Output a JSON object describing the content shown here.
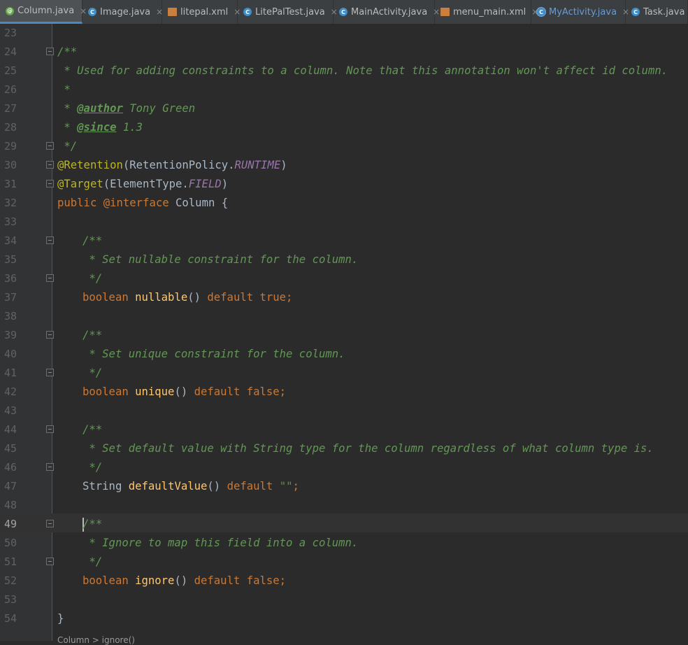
{
  "tabs": [
    {
      "label": "Column.java",
      "icon": "annotation-icon",
      "active": true
    },
    {
      "label": "Image.java",
      "icon": "class-icon"
    },
    {
      "label": "litepal.xml",
      "icon": "xml-icon"
    },
    {
      "label": "LitePalTest.java",
      "icon": "class-icon"
    },
    {
      "label": "MainActivity.java",
      "icon": "class-icon"
    },
    {
      "label": "menu_main.xml",
      "icon": "xml-icon"
    },
    {
      "label": "MyActivity.java",
      "icon": "class-icon"
    },
    {
      "label": "Task.java",
      "icon": "class-icon"
    }
  ],
  "close_glyph": "×",
  "line_numbers": [
    "23",
    "24",
    "25",
    "26",
    "27",
    "28",
    "29",
    "30",
    "31",
    "32",
    "33",
    "34",
    "35",
    "36",
    "37",
    "38",
    "39",
    "40",
    "41",
    "42",
    "43",
    "44",
    "45",
    "46",
    "47",
    "48",
    "49",
    "50",
    "51",
    "52",
    "53",
    "54"
  ],
  "current_line": "49",
  "code": {
    "l24": "/**",
    "l25": " * Used for adding constraints to a column. Note that this annotation won't affect id column.",
    "l26": " *",
    "l27_star": " * ",
    "l27_tag": "@author",
    "l27_text": " Tony Green",
    "l28_star": " * ",
    "l28_tag": "@since",
    "l28_text": " 1.3",
    "l29": " */",
    "l30_anno": "@Retention",
    "l30_open": "(RetentionPolicy.",
    "l30_const": "RUNTIME",
    "l30_close": ")",
    "l31_anno": "@Target",
    "l31_open": "(ElementType.",
    "l31_const": "FIELD",
    "l31_close": ")",
    "l32_kw1": "public",
    "l32_kw2": "@interface",
    "l32_name": "Column",
    "l32_brace": "{",
    "l34": "/**",
    "l35": " * Set nullable constraint for the column.",
    "l36": " */",
    "l37_type": "boolean",
    "l37_name": "nullable",
    "l37_paren": "()",
    "l37_kw": "default",
    "l37_val": "true;",
    "l39": "/**",
    "l40": " * Set unique constraint for the column.",
    "l41": " */",
    "l42_type": "boolean",
    "l42_name": "unique",
    "l42_paren": "()",
    "l42_kw": "default",
    "l42_val": "false;",
    "l44": "/**",
    "l45": " * Set default value with String type for the column regardless of what column type is.",
    "l46": " */",
    "l47_type": "String",
    "l47_name": "defaultValue",
    "l47_paren": "()",
    "l47_kw": "default",
    "l47_str": "\"\"",
    "l47_semi": ";",
    "l49": "/**",
    "l50": " * Ignore to map this field into a column.",
    "l51": " */",
    "l52_type": "boolean",
    "l52_name": "ignore",
    "l52_paren": "()",
    "l52_kw": "default",
    "l52_val": "false;",
    "l54": "}"
  },
  "bottom_crumb": "Column > ignore()"
}
